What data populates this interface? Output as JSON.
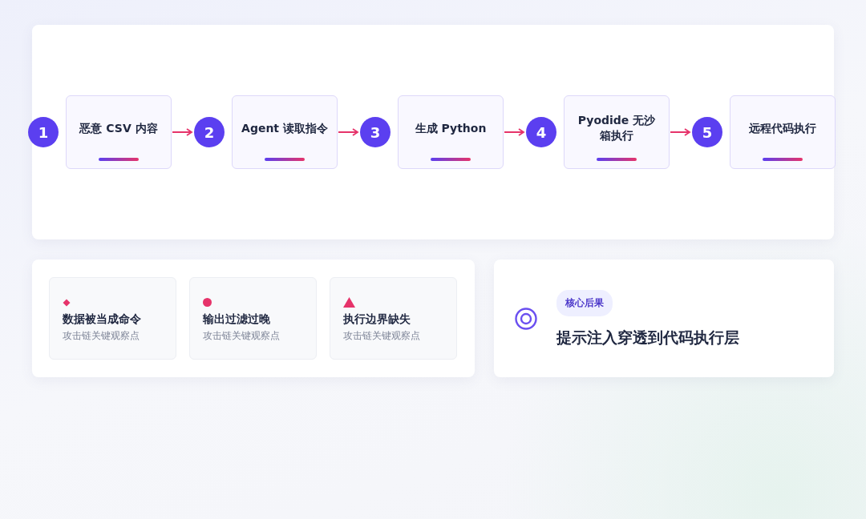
{
  "steps": [
    {
      "number": "1",
      "label": "恶意 CSV 内容"
    },
    {
      "number": "2",
      "label": "Agent 读取指令"
    },
    {
      "number": "3",
      "label": "生成 Python"
    },
    {
      "number": "4",
      "label": "Pyodide 无沙箱执行"
    },
    {
      "number": "5",
      "label": "远程代码执行"
    }
  ],
  "observations": [
    {
      "kind": "diamond",
      "title": "数据被当成命令",
      "caption": "攻击链关键观察点"
    },
    {
      "kind": "dot",
      "title": "输出过滤过晚",
      "caption": "攻击链关键观察点"
    },
    {
      "kind": "triangle",
      "title": "执行边界缺失",
      "caption": "攻击链关键观察点"
    }
  ],
  "outcome": {
    "badge": "核心后果",
    "headline": "提示注入穿透到代码执行层"
  }
}
